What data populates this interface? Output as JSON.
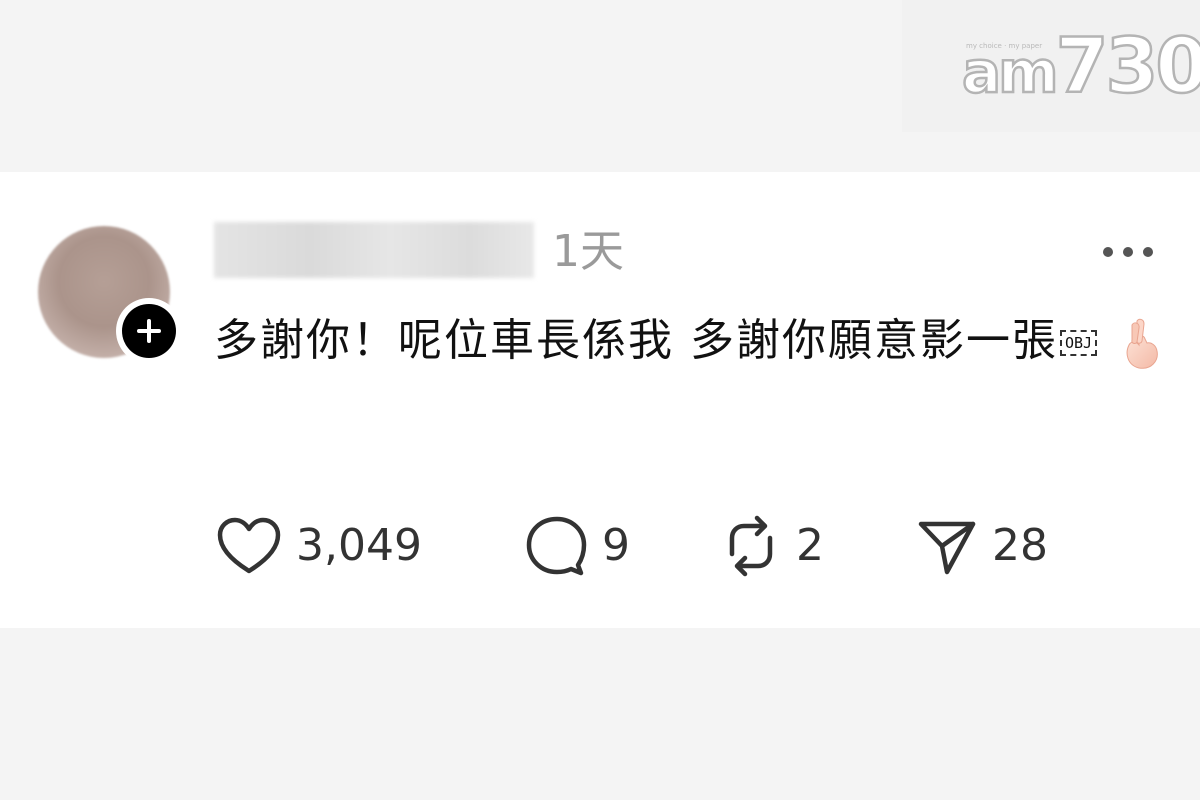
{
  "watermark": {
    "tagline": "my choice · my paper",
    "brand_prefix": "am",
    "brand_number": "730"
  },
  "post": {
    "timestamp": "1天",
    "text": "多謝你！呢位車長係我 多謝你願意影一張",
    "obj_placeholder": "OBJ",
    "emoji_icon": "pinched-fingers-heart-emoji",
    "more_icon": "ellipsis-icon",
    "follow_icon": "plus-icon"
  },
  "actions": {
    "likes": "3,049",
    "comments": "9",
    "reposts": "2",
    "shares": "28"
  },
  "colors": {
    "text": "#111111",
    "muted": "#9a9a9a",
    "icon": "#333333",
    "background": "#ffffff",
    "band": "#f4f4f4"
  }
}
